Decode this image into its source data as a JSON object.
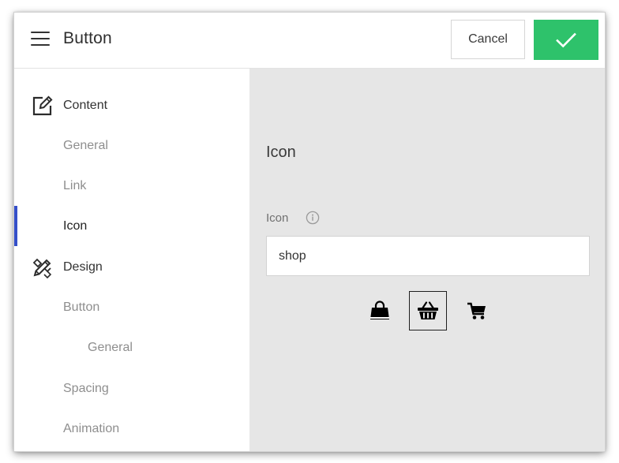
{
  "header": {
    "title": "Button",
    "cancel_label": "Cancel",
    "confirm_icon": "check-icon",
    "confirm_color": "#2ec26b"
  },
  "sidebar": {
    "accent_color": "#3550c9",
    "items": [
      {
        "label": "Content",
        "type": "section",
        "icon": "edit-icon"
      },
      {
        "label": "General",
        "type": "sub"
      },
      {
        "label": "Link",
        "type": "sub"
      },
      {
        "label": "Icon",
        "type": "sub",
        "active": true
      },
      {
        "label": "Design",
        "type": "section",
        "icon": "design-tools-icon"
      },
      {
        "label": "Button",
        "type": "sub"
      },
      {
        "label": "General",
        "type": "sub-nested"
      },
      {
        "label": "Spacing",
        "type": "sub"
      },
      {
        "label": "Animation",
        "type": "sub"
      }
    ]
  },
  "main": {
    "section_title": "Icon",
    "field": {
      "label": "Icon",
      "value": "shop"
    },
    "icon_results": [
      {
        "name": "shopping-bag-icon",
        "selected": false
      },
      {
        "name": "shopping-basket-icon",
        "selected": true
      },
      {
        "name": "shopping-cart-icon",
        "selected": false
      }
    ]
  }
}
